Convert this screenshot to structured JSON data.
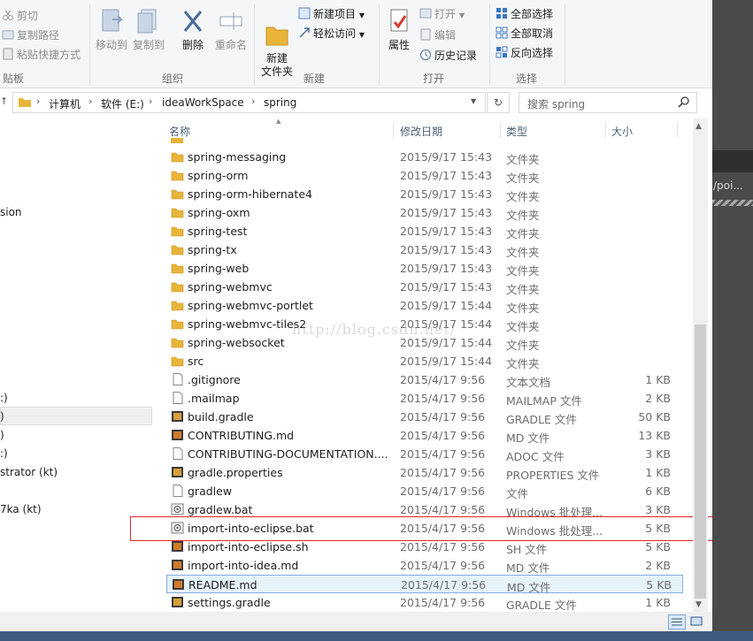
{
  "ribbon": {
    "clipboard": {
      "cut": "剪切",
      "copy_path": "复制路径",
      "paste_shortcut": "粘贴快捷方式",
      "group": "贴板"
    },
    "organize": {
      "move_to": "移动到",
      "copy_to": "复制到",
      "delete": "删除",
      "rename": "重命名",
      "group": "组织"
    },
    "new": {
      "new_folder": "新建\n文件夹",
      "new_item": "新建项目",
      "easy_access": "轻松访问",
      "group": "新建"
    },
    "open": {
      "properties": "属性",
      "open": "打开",
      "edit": "编辑",
      "history": "历史记录",
      "group": "打开"
    },
    "select": {
      "select_all": "全部选择",
      "select_none": "全部取消",
      "invert": "反向选择",
      "group": "选择"
    }
  },
  "address": {
    "crumbs": [
      "计算机",
      "软件 (E:)",
      "ideaWorkSpace",
      "spring"
    ],
    "search_placeholder": "搜索 spring"
  },
  "nav": {
    "items": [
      "sion",
      ":)",
      ")",
      ")",
      ":)",
      "strator (kt)",
      "7ka (kt)"
    ]
  },
  "columns": {
    "name": "名称",
    "date": "修改日期",
    "type": "类型",
    "size": "大小"
  },
  "files": [
    {
      "name": "spring-messaging",
      "date": "2015/9/17 15:43",
      "type": "文件夹",
      "size": "",
      "icon": "folder-icon"
    },
    {
      "name": "spring-orm",
      "date": "2015/9/17 15:43",
      "type": "文件夹",
      "size": "",
      "icon": "folder-icon"
    },
    {
      "name": "spring-orm-hibernate4",
      "date": "2015/9/17 15:43",
      "type": "文件夹",
      "size": "",
      "icon": "folder-icon"
    },
    {
      "name": "spring-oxm",
      "date": "2015/9/17 15:43",
      "type": "文件夹",
      "size": "",
      "icon": "folder-icon"
    },
    {
      "name": "spring-test",
      "date": "2015/9/17 15:43",
      "type": "文件夹",
      "size": "",
      "icon": "folder-icon"
    },
    {
      "name": "spring-tx",
      "date": "2015/9/17 15:43",
      "type": "文件夹",
      "size": "",
      "icon": "folder-icon"
    },
    {
      "name": "spring-web",
      "date": "2015/9/17 15:43",
      "type": "文件夹",
      "size": "",
      "icon": "folder-icon"
    },
    {
      "name": "spring-webmvc",
      "date": "2015/9/17 15:43",
      "type": "文件夹",
      "size": "",
      "icon": "folder-icon"
    },
    {
      "name": "spring-webmvc-portlet",
      "date": "2015/9/17 15:44",
      "type": "文件夹",
      "size": "",
      "icon": "folder-icon"
    },
    {
      "name": "spring-webmvc-tiles2",
      "date": "2015/9/17 15:44",
      "type": "文件夹",
      "size": "",
      "icon": "folder-icon"
    },
    {
      "name": "spring-websocket",
      "date": "2015/9/17 15:44",
      "type": "文件夹",
      "size": "",
      "icon": "folder-icon"
    },
    {
      "name": "src",
      "date": "2015/9/17 15:44",
      "type": "文件夹",
      "size": "",
      "icon": "folder-icon"
    },
    {
      "name": ".gitignore",
      "date": "2015/4/17 9:56",
      "type": "文本文档",
      "size": "1 KB",
      "icon": "file-icon"
    },
    {
      "name": ".mailmap",
      "date": "2015/4/17 9:56",
      "type": "MAILMAP 文件",
      "size": "2 KB",
      "icon": "file-icon"
    },
    {
      "name": "build.gradle",
      "date": "2015/4/17 9:56",
      "type": "GRADLE 文件",
      "size": "50 KB",
      "icon": "gradle-file-icon"
    },
    {
      "name": "CONTRIBUTING.md",
      "date": "2015/4/17 9:56",
      "type": "MD 文件",
      "size": "13 KB",
      "icon": "md-file-icon"
    },
    {
      "name": "CONTRIBUTING-DOCUMENTATION....",
      "date": "2015/4/17 9:56",
      "type": "ADOC 文件",
      "size": "3 KB",
      "icon": "file-icon"
    },
    {
      "name": "gradle.properties",
      "date": "2015/4/17 9:56",
      "type": "PROPERTIES 文件",
      "size": "1 KB",
      "icon": "gradle-file-icon"
    },
    {
      "name": "gradlew",
      "date": "2015/4/17 9:56",
      "type": "文件",
      "size": "6 KB",
      "icon": "file-icon"
    },
    {
      "name": "gradlew.bat",
      "date": "2015/4/17 9:56",
      "type": "Windows 批处理...",
      "size": "3 KB",
      "icon": "bat-file-icon"
    },
    {
      "name": "import-into-eclipse.bat",
      "date": "2015/4/17 9:56",
      "type": "Windows 批处理...",
      "size": "5 KB",
      "icon": "bat-file-icon"
    },
    {
      "name": "import-into-eclipse.sh",
      "date": "2015/4/17 9:56",
      "type": "SH 文件",
      "size": "5 KB",
      "icon": "md-file-icon"
    },
    {
      "name": "import-into-idea.md",
      "date": "2015/4/17 9:56",
      "type": "MD 文件",
      "size": "2 KB",
      "icon": "md-file-icon"
    },
    {
      "name": "README.md",
      "date": "2015/4/17 9:56",
      "type": "MD 文件",
      "size": "5 KB",
      "icon": "md-file-icon"
    },
    {
      "name": "settings.gradle",
      "date": "2015/4/17 9:56",
      "type": "GRADLE 文件",
      "size": "1 KB",
      "icon": "gradle-file-icon"
    }
  ],
  "selected_index": 23,
  "highlight_index": 20,
  "watermark": "http://blog.csdn.net/",
  "side_text": "/poi...",
  "colors": {
    "folder": "#e8b53a",
    "highlight_border": "#e0262c",
    "select_bg": "#e5f3fb",
    "select_border": "#84acdd"
  }
}
